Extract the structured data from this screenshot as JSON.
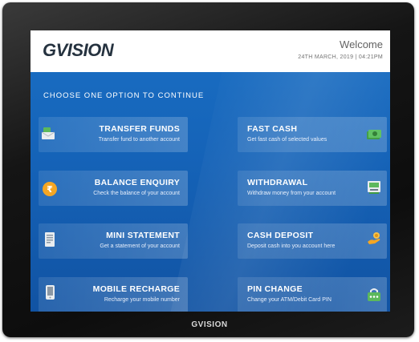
{
  "brand": {
    "logo": "GVISION",
    "bezel_logo": "GVISION"
  },
  "header": {
    "welcome": "Welcome",
    "datetime": "24TH MARCH, 2019 | 04:21PM"
  },
  "prompt": "CHOOSE ONE OPTION TO CONTINUE",
  "options": [
    {
      "title": "TRANSFER FUNDS",
      "subtitle": "Transfer fund to another account",
      "icon": "money-envelope-icon"
    },
    {
      "title": "FAST CASH",
      "subtitle": "Get fast cash of selected values",
      "icon": "cash-icon"
    },
    {
      "title": "BALANCE ENQUIRY",
      "subtitle": "Check the balance of your account",
      "icon": "rupee-coin-icon"
    },
    {
      "title": "WITHDRAWAL",
      "subtitle": "Withdraw money from your account",
      "icon": "atm-machine-icon"
    },
    {
      "title": "MINI STATEMENT",
      "subtitle": "Get a statement of your account",
      "icon": "statement-icon"
    },
    {
      "title": "CASH DEPOSIT",
      "subtitle": "Deposit cash into you account here",
      "icon": "hand-coin-icon"
    },
    {
      "title": "MOBILE RECHARGE",
      "subtitle": "Recharge your mobile number",
      "icon": "mobile-phone-icon"
    },
    {
      "title": "PIN CHANGE",
      "subtitle": "Change your ATM/Debit Card PIN",
      "icon": "pin-keypad-icon"
    }
  ],
  "colors": {
    "screen_blue": "#1563b8",
    "icon_green": "#4caf50",
    "icon_orange": "#f5a623"
  }
}
